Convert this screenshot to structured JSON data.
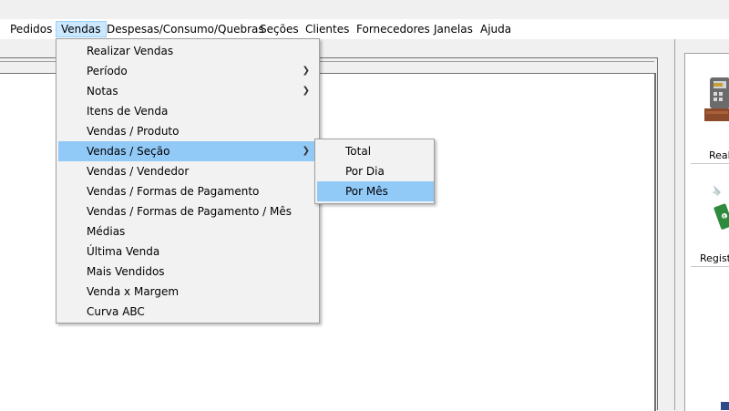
{
  "menubar": {
    "items": [
      {
        "label": "Pedidos"
      },
      {
        "label": "Vendas"
      },
      {
        "label": "Despesas/Consumo/Quebras"
      },
      {
        "label": "Seções"
      },
      {
        "label": "Clientes"
      },
      {
        "label": "Fornecedores"
      },
      {
        "label": "Janelas"
      },
      {
        "label": "Ajuda"
      }
    ]
  },
  "vendas_menu": {
    "items": [
      {
        "label": "Realizar Vendas"
      },
      {
        "label": "Período"
      },
      {
        "label": "Notas"
      },
      {
        "label": "Itens de Venda"
      },
      {
        "label": "Vendas / Produto"
      },
      {
        "label": "Vendas / Seção"
      },
      {
        "label": "Vendas / Vendedor"
      },
      {
        "label": "Vendas / Formas de Pagamento"
      },
      {
        "label": "Vendas / Formas de Pagamento / Mês"
      },
      {
        "label": "Médias"
      },
      {
        "label": "Última Venda"
      },
      {
        "label": "Mais Vendidos"
      },
      {
        "label": "Venda x Margem"
      },
      {
        "label": "Curva ABC"
      }
    ]
  },
  "secao_submenu": {
    "items": [
      {
        "label": "Total"
      },
      {
        "label": "Por Dia"
      },
      {
        "label": "Por Mês"
      }
    ]
  },
  "side_toolbar": {
    "tool1_label": "Real",
    "tool2_label": "Registr"
  },
  "colors": {
    "highlight": "#91c9f7",
    "menubar_active": "#cce8ff"
  },
  "icons": {
    "submenu_arrow": "chevron-right-icon",
    "tool1": "cash-register-icon",
    "tool2": "money-icon"
  }
}
